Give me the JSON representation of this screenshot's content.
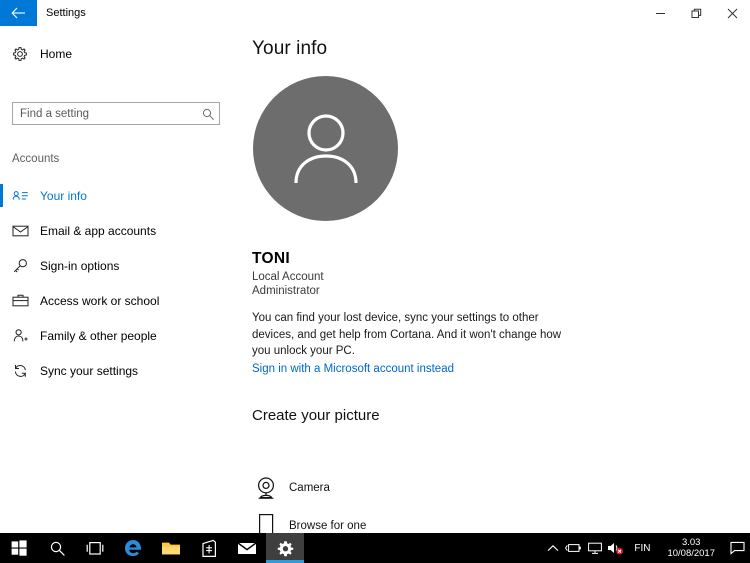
{
  "window": {
    "title": "Settings",
    "back_icon": "back-arrow-icon",
    "accent_color": "#0078d7",
    "controls": {
      "minimize": "minimize-icon",
      "restore": "restore-icon",
      "close": "close-icon"
    }
  },
  "sidebar": {
    "home": {
      "label": "Home",
      "icon": "gear-icon"
    },
    "search": {
      "placeholder": "Find a setting",
      "value": "",
      "icon": "search-icon"
    },
    "group_label": "Accounts",
    "items": [
      {
        "label": "Your info",
        "icon": "contact-card-icon",
        "selected": true
      },
      {
        "label": "Email & app accounts",
        "icon": "envelope-icon",
        "selected": false
      },
      {
        "label": "Sign-in options",
        "icon": "key-icon",
        "selected": false
      },
      {
        "label": "Access work or school",
        "icon": "briefcase-icon",
        "selected": false
      },
      {
        "label": "Family & other people",
        "icon": "person-add-icon",
        "selected": false
      },
      {
        "label": "Sync your settings",
        "icon": "sync-icon",
        "selected": false
      }
    ]
  },
  "main": {
    "page_title": "Your info",
    "avatar": {
      "icon": "person-avatar-icon",
      "background_color": "#6d6d6d"
    },
    "account": {
      "name": "TONI",
      "type": "Local Account",
      "role": "Administrator"
    },
    "description": "You can find your lost device, sync your settings to other devices, and get help from Cortana. And it won't change how you unlock your PC.",
    "msa_link": {
      "text": "Sign in with a Microsoft account instead",
      "color": "#0066cc"
    },
    "picture_section": {
      "title": "Create your picture",
      "options": [
        {
          "label": "Camera",
          "icon": "webcam-icon"
        },
        {
          "label": "Browse for one",
          "icon": "browse-file-icon"
        }
      ]
    }
  },
  "taskbar": {
    "buttons": [
      {
        "name": "start-button",
        "icon": "windows-logo-icon",
        "active": false
      },
      {
        "name": "search-button",
        "icon": "search-icon",
        "active": false
      },
      {
        "name": "task-view-button",
        "icon": "task-view-icon",
        "active": false
      },
      {
        "name": "edge-button",
        "icon": "edge-icon",
        "active": false
      },
      {
        "name": "file-explorer-button",
        "icon": "folder-icon",
        "active": false
      },
      {
        "name": "store-button",
        "icon": "store-bag-icon",
        "active": false
      },
      {
        "name": "mail-button",
        "icon": "mail-icon",
        "active": false
      },
      {
        "name": "settings-button",
        "icon": "gear-icon",
        "active": true
      }
    ],
    "tray": {
      "show_hidden_icon": "chevron-up-icon",
      "battery_icon": "battery-charging-icon",
      "network_icon": "network-icon",
      "volume_icon": "speaker-muted-icon",
      "language": "FIN",
      "time": "3.03",
      "date": "10/08/2017",
      "action_center_icon": "action-center-icon"
    }
  }
}
